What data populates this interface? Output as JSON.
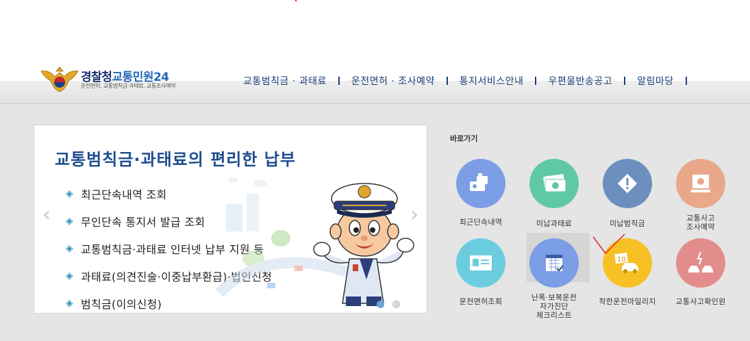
{
  "logo": {
    "title_1": "경찰청",
    "title_2": "교통민원24",
    "subtitle": "운전면허, 교통범칙금·과태료, 교통조사예약"
  },
  "nav": {
    "items": [
      {
        "label": "교통범칙금 · 과태료"
      },
      {
        "label": "운전면허 · 조사예약"
      },
      {
        "label": "통지서비스안내"
      },
      {
        "label": "우편물반송공고"
      },
      {
        "label": "알림마당"
      }
    ]
  },
  "banner": {
    "title": "교통범칙금·과태료의 편리한 납부",
    "bullet": "◈",
    "items": [
      {
        "label": "최근단속내역 조회"
      },
      {
        "label": "무인단속 통지서 발급 조회"
      },
      {
        "label": "교통범칙금·과태료 인터넷 납부 지원 등"
      },
      {
        "label": "과태료(의견진술·이중납부환급)·법인신청"
      },
      {
        "label": "범칙금(이의신청)"
      }
    ],
    "prev": "‹",
    "next": "›",
    "slide_count": 2,
    "active_slide": 1
  },
  "quick": {
    "title": "바로가기",
    "items": [
      {
        "label": "최근단속내역",
        "icon": "camera-icon",
        "color": "#7c9ee6"
      },
      {
        "label": "미납과태료",
        "icon": "money-icon",
        "color": "#5ec9a4"
      },
      {
        "label": "미납범칙금",
        "icon": "warning-icon",
        "color": "#6c8fc0"
      },
      {
        "label": "교통사고\n조사예약",
        "icon": "monitor-icon",
        "color": "#e9a88a"
      },
      {
        "label": "운전면허조회",
        "icon": "license-icon",
        "color": "#6ccde0"
      },
      {
        "label": "난폭·보복운전\n자가진단\n체크리스트",
        "icon": "calendar-icon",
        "color": "#7c9ee6"
      },
      {
        "label": "착한운전마일리지",
        "icon": "car-badge-icon",
        "color": "#f7c125"
      },
      {
        "label": "교통사고확인원",
        "icon": "accident-icon",
        "color": "#e38c8c"
      }
    ]
  }
}
